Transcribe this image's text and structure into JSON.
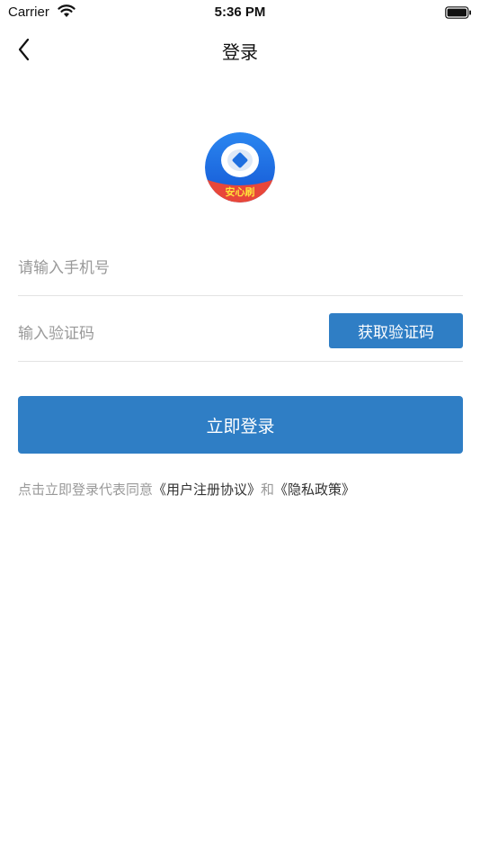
{
  "status_bar": {
    "carrier": "Carrier",
    "time": "5:36 PM"
  },
  "nav": {
    "title": "登录",
    "back_icon": "chevron-left-icon"
  },
  "logo": {
    "text": "安心刷",
    "colors": {
      "blue": "#1e6fe0",
      "red": "#e8473a",
      "text": "#ffe23a"
    }
  },
  "form": {
    "phone_placeholder": "请输入手机号",
    "code_placeholder": "输入验证码",
    "get_code_label": "获取验证码",
    "login_label": "立即登录"
  },
  "agreement": {
    "prefix": "点击立即登录代表同意",
    "terms_link": "《用户注册协议》",
    "conjunction": "和",
    "privacy_link": "《隐私政策》"
  },
  "colors": {
    "accent": "#2f7ec5"
  }
}
